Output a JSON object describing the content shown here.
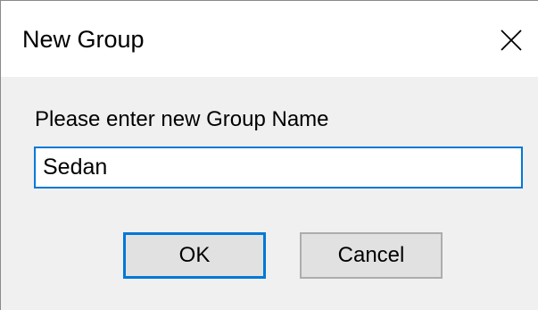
{
  "window": {
    "title": "New Group",
    "close_icon": "close-icon"
  },
  "dialog": {
    "prompt": "Please enter new Group Name",
    "group_name_value": "Sedan",
    "ok_label": "OK",
    "cancel_label": "Cancel"
  },
  "colors": {
    "accent": "#0078d7",
    "titlebar": "#ffffff",
    "body": "#f0f0f0",
    "button_face": "#e1e1e1"
  }
}
